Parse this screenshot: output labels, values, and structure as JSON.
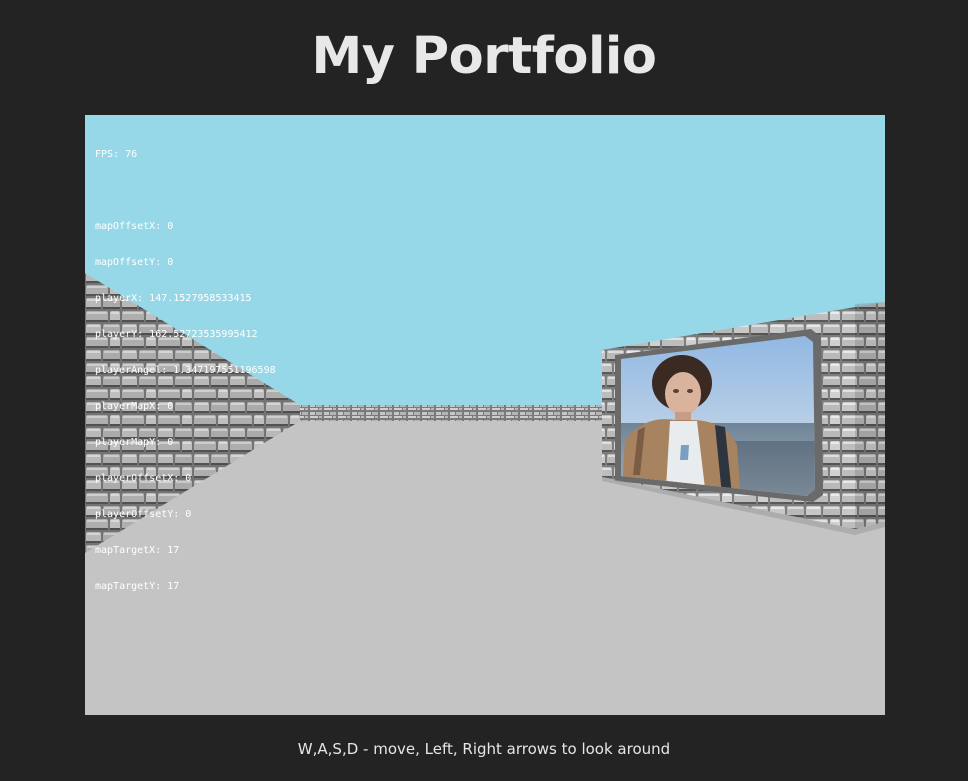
{
  "page": {
    "title": "My Portfolio",
    "instructions": "W,A,S,D - move, Left, Right arrows to look around"
  },
  "debug": {
    "fps": "FPS: 76",
    "lines": [
      "mapOffsetX: 0",
      "mapOffsetY: 0",
      "playerX: 147.1527958533415",
      "playerY: 162.52723535995412",
      "playerAngel: 1.347197551196598",
      "playerMapX: 0",
      "playerMapY: 0",
      "playerOffsetX: 0",
      "playerOffsetY: 0",
      "mapTargetX: 17",
      "mapTargetY: 17"
    ]
  },
  "scene": {
    "sky_color": "#96d8e8",
    "floor_color": "#c4c4c4",
    "wall_color": "#8c8c8c",
    "wall_texture": "stone-brick",
    "frame_item": "portrait-photo"
  }
}
